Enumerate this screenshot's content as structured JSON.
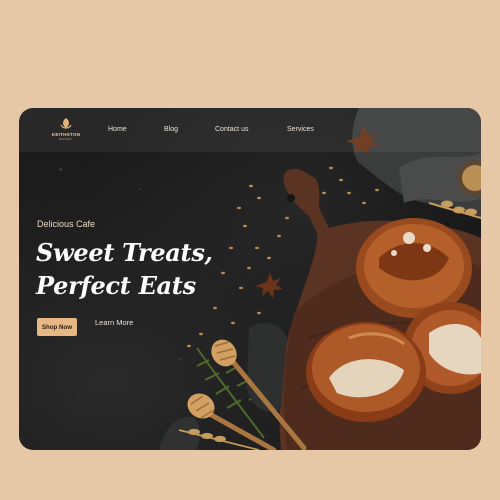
{
  "brand": {
    "name": "KEITHSTON",
    "tagline": "BAKERY"
  },
  "nav": {
    "items": [
      {
        "label": "Home"
      },
      {
        "label": "Blog"
      },
      {
        "label": "Contact us"
      },
      {
        "label": "Services"
      }
    ]
  },
  "hero": {
    "eyebrow": "Delicious Cafe",
    "title_line1": "Sweet Treats,",
    "title_line2": "Perfect Eats",
    "primary_cta": "Shop Now",
    "secondary_cta": "Learn More"
  },
  "colors": {
    "page_background": "#e6c8a6",
    "accent": "#e7b883",
    "dark_background": "#1a1a1a"
  },
  "icons": [
    "leaf-logo-icon"
  ]
}
